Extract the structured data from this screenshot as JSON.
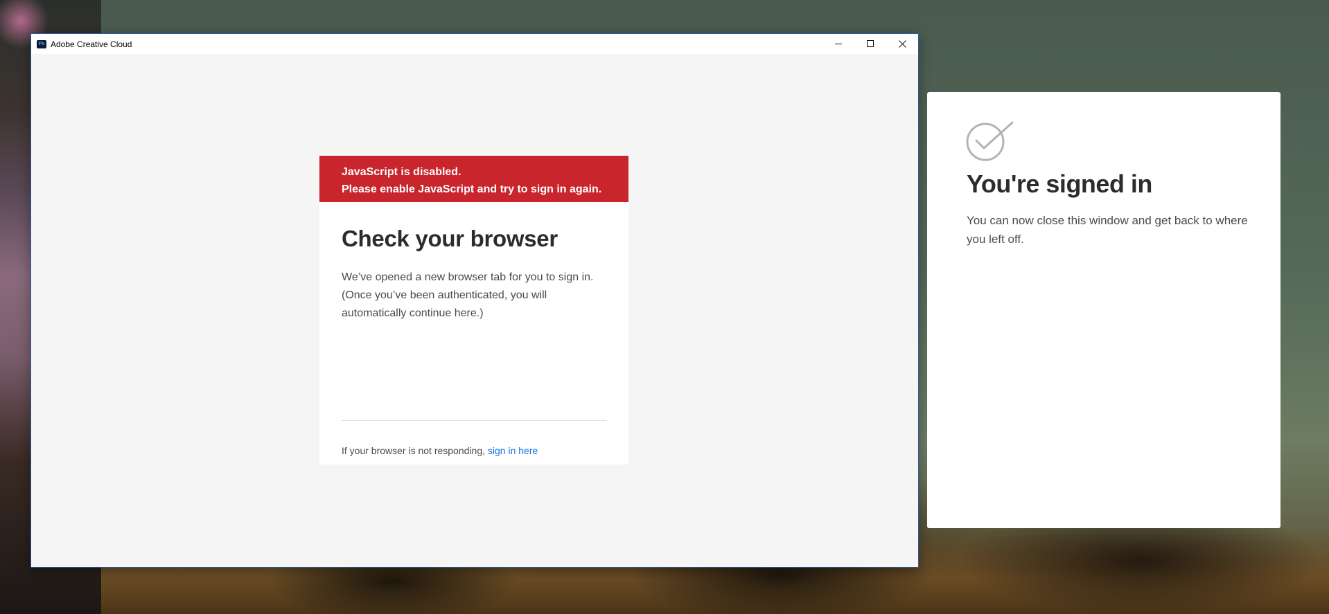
{
  "window": {
    "title": "Adobe Creative Cloud",
    "app_icon_text": "Ps",
    "controls": {
      "minimize": "minimize-icon",
      "maximize": "maximize-icon",
      "close": "close-icon"
    }
  },
  "dialog": {
    "error_line1": "JavaScript is disabled.",
    "error_line2": "Please enable JavaScript and try to sign in again.",
    "heading": "Check your browser",
    "body_line1": "We’ve opened a new browser tab for you to sign in.",
    "body_line2": "(Once you’ve been authenticated, you will",
    "body_line3": "automatically continue here.)",
    "footer_text": "If your browser is not responding,",
    "footer_link": "sign in here"
  },
  "signed_in": {
    "icon": "checkmark-circle-icon",
    "heading": "You're signed in",
    "line1": "You can now close this window and get back to where",
    "line2": "you left off."
  },
  "colors": {
    "error_banner": "#c9252d",
    "link": "#1473e6"
  }
}
